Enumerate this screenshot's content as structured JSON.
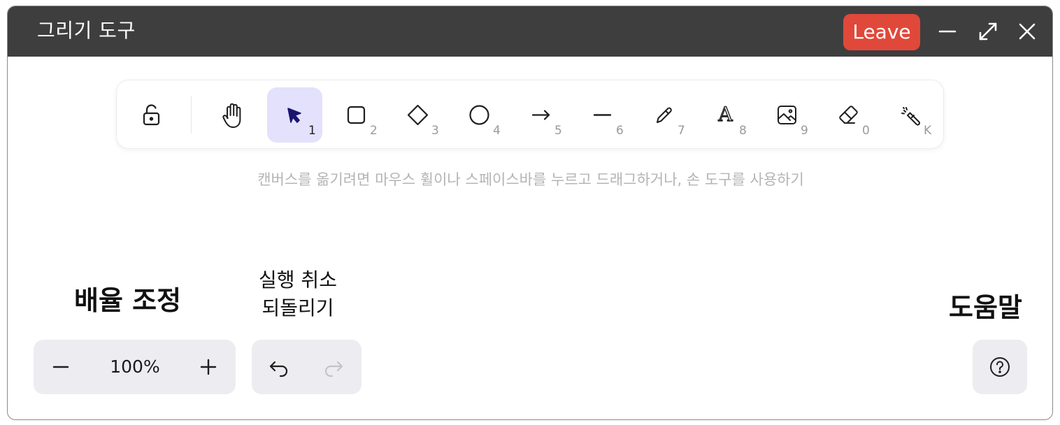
{
  "window": {
    "title": "그리기 도구",
    "leave_label": "Leave"
  },
  "toolbar": {
    "tools": [
      {
        "name": "lock",
        "key": ""
      },
      {
        "name": "hand",
        "key": ""
      },
      {
        "name": "selection",
        "key": "1",
        "active": true
      },
      {
        "name": "rectangle",
        "key": "2"
      },
      {
        "name": "diamond",
        "key": "3"
      },
      {
        "name": "ellipse",
        "key": "4"
      },
      {
        "name": "arrow",
        "key": "5"
      },
      {
        "name": "line",
        "key": "6"
      },
      {
        "name": "draw",
        "key": "7"
      },
      {
        "name": "text",
        "key": "8"
      },
      {
        "name": "image",
        "key": "9"
      },
      {
        "name": "eraser",
        "key": "0"
      },
      {
        "name": "laser",
        "key": "K"
      }
    ],
    "active_color": "#e3e1fb"
  },
  "hint": "캔버스를 옮기려면 마우스 휠이나 스페이스바를 누르고 드래그하거나, 손 도구를 사용하기",
  "labels": {
    "zoom": "배율 조정",
    "undo_line1": "실행 취소",
    "undo_line2": "되돌리기",
    "help": "도움말"
  },
  "zoom": {
    "value": "100%"
  },
  "colors": {
    "titlebar": "#3e3e3e",
    "leave": "#e0483a",
    "panel": "#ececf1"
  }
}
